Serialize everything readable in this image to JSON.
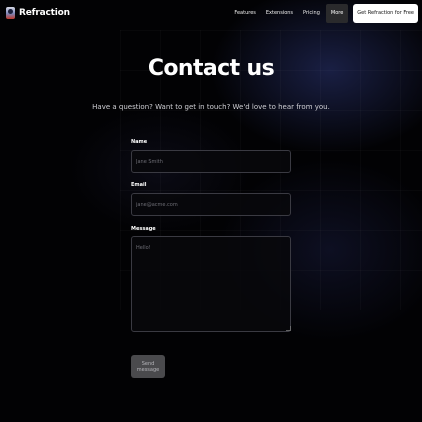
{
  "nav": {
    "brand": "Refraction",
    "links": [
      "Features",
      "Extensions",
      "Pricing"
    ],
    "more_label": "More",
    "cta_label": "Get Refraction for Free"
  },
  "header": {
    "title": "Contact us",
    "subtitle": "Have a question? Want to get in touch? We'd love to hear from you."
  },
  "form": {
    "name_label": "Name",
    "name_placeholder": "Jane Smith",
    "email_label": "Email",
    "email_placeholder": "jane@acme.com",
    "message_label": "Message",
    "message_placeholder": "Hello!",
    "submit_label": "Send message"
  },
  "colors": {
    "background": "#020204",
    "accent_glow": "#2d3778",
    "button_disabled": "#4a4a4d",
    "cta_background": "#ffffff"
  },
  "icons": {
    "brand": "refraction-logo-icon",
    "textarea_resize": "resize-grip-icon"
  }
}
